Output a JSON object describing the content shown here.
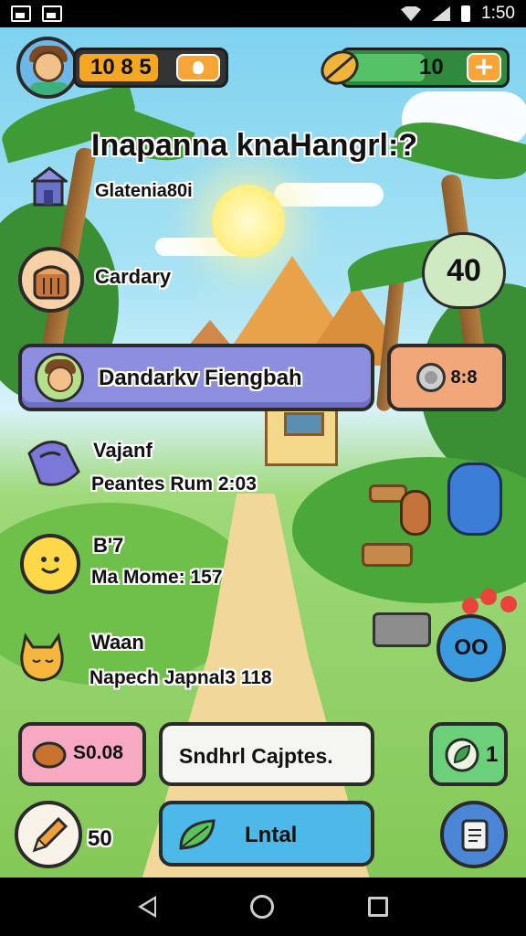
{
  "status_bar": {
    "time": "1:50"
  },
  "hud": {
    "coins_value": "10 8 5",
    "coins_fill": 0.55,
    "leaves_value": "10",
    "leaves_fill": 0.5,
    "plus_label": "+"
  },
  "header": {
    "title": "Inapanna knaHangrl:?",
    "subtitle": "Glatenia80i"
  },
  "rows": {
    "cardary_label": "Cardary",
    "badge_value": "40",
    "quest_label": "Dandarkv Fiengbah",
    "counter_label": "8:8",
    "row1_title": "Vajanf",
    "row1_sub": "Peantes Rum 2:03",
    "row2_title": "B'7",
    "row2_sub": "Ma Mome: 157",
    "row3_title": "Waan",
    "row3_sub": "Napech Japnal3 118",
    "owl_label": "OO"
  },
  "bottom": {
    "wood_value": "S0.08",
    "action_label": "Sndhrl Cajptes.",
    "leaf_count": "1",
    "pencil_count": "50",
    "primary_label": "Lntal"
  },
  "colors": {
    "quest_bar": "#8d8ee0",
    "counter_card": "#f1a77a",
    "wood_card": "#f7a9c3",
    "primary_button": "#4db9e8",
    "leaf_button": "#6cd07a",
    "scroll_button": "#4b86d6"
  },
  "icons": [
    "image-icon",
    "gallery-icon",
    "wifi-icon",
    "signal-icon",
    "battery-icon",
    "lightbulb-icon",
    "leaf-coin-icon",
    "plus-icon",
    "house-icon",
    "cake-icon",
    "gear-icon",
    "bread-icon",
    "pencil-icon",
    "leaf-icon",
    "scroll-icon",
    "back-icon",
    "home-icon",
    "recent-apps-icon"
  ]
}
